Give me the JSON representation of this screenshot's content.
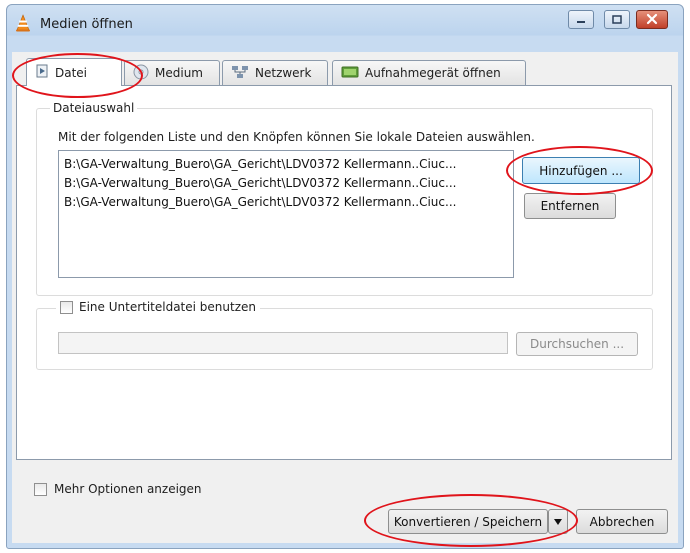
{
  "window": {
    "title": "Medien öffnen",
    "icon": "vlc-cone-icon"
  },
  "tabs": [
    {
      "label": "Datei",
      "icon": "file-icon",
      "active": true
    },
    {
      "label": "Medium",
      "icon": "disc-icon",
      "active": false
    },
    {
      "label": "Netzwerk",
      "icon": "network-icon",
      "active": false
    },
    {
      "label": "Aufnahmegerät öffnen",
      "icon": "capture-device-icon",
      "active": false
    }
  ],
  "file_selection": {
    "legend": "Dateiauswahl",
    "description": "Mit der folgenden Liste und den Knöpfen können Sie lokale Dateien auswählen.",
    "files": [
      "B:\\GA-Verwaltung_Buero\\GA_Gericht\\LDV0372  Kellermann..Ciuc...",
      "B:\\GA-Verwaltung_Buero\\GA_Gericht\\LDV0372  Kellermann..Ciuc...",
      "B:\\GA-Verwaltung_Buero\\GA_Gericht\\LDV0372  Kellermann..Ciuc..."
    ],
    "add_button": "Hinzufügen ...",
    "remove_button": "Entfernen"
  },
  "subtitle": {
    "checkbox_label": "Eine Untertiteldatei benutzen",
    "checked": false,
    "path_value": "",
    "browse_button": "Durchsuchen ..."
  },
  "footer": {
    "more_options_label": "Mehr Optionen anzeigen",
    "more_options_checked": false,
    "convert_button": "Konvertieren / Speichern",
    "cancel_button": "Abbrechen"
  },
  "colors": {
    "highlight_ellipse": "#e0141b",
    "focus_border": "#3c7fb1"
  }
}
